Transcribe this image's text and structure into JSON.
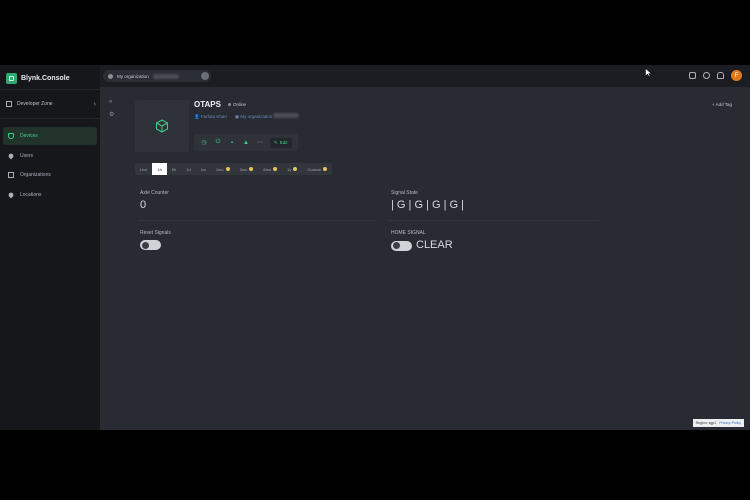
{
  "brand": {
    "name": "Blynk.Console"
  },
  "sidebar": {
    "zone_label": "Developer Zone",
    "items": [
      {
        "label": "Devices",
        "icon": "shield-icon",
        "active": true
      },
      {
        "label": "Users",
        "icon": "person-icon",
        "active": false
      },
      {
        "label": "Organizations",
        "icon": "organization-icon",
        "active": false
      },
      {
        "label": "Locations",
        "icon": "location-pin-icon",
        "active": false
      }
    ]
  },
  "topbar": {
    "org_label": "My organization",
    "avatar_initial": "F"
  },
  "device": {
    "name": "OTAPS",
    "status": "Online",
    "owner": "Farhan Khan",
    "org": "My organization",
    "add_tag": "+ Add Tag",
    "edit_label": "Edit"
  },
  "time_tabs": [
    "Live",
    "1h",
    "6h",
    "1d",
    "1w",
    "1mo",
    "3mo",
    "6mo",
    "1y",
    "Custom"
  ],
  "active_time_tab": "1h",
  "widgets": {
    "axle_counter": {
      "label": "Axle Counter",
      "value": "0"
    },
    "signal_state": {
      "label": "Signal State",
      "value": "| G | G | G | G |"
    },
    "reset_signals": {
      "label": "Reset Signals"
    },
    "home_signal": {
      "label": "HOME SIGNAL",
      "value": "CLEAR"
    }
  },
  "footer": {
    "region": "Region: sgp1",
    "privacy": "Privacy Policy"
  },
  "colors": {
    "accent": "#3fcf86",
    "background": "#282b31",
    "sidebar": "#15171b"
  }
}
